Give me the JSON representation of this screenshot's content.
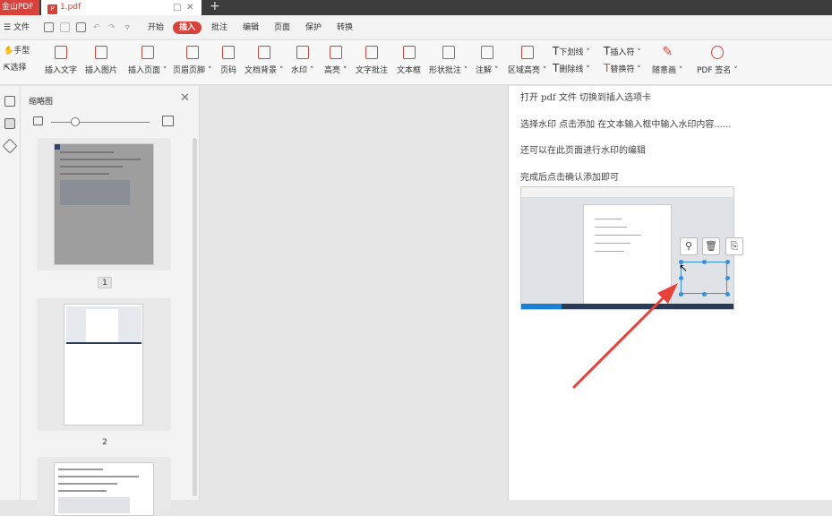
{
  "titlebar": {
    "app_name": "金山PDF",
    "doc_tab": "1.pdf",
    "new_tab_symbol": "+"
  },
  "menu": {
    "file": "文件",
    "items": [
      "开始",
      "插入",
      "批注",
      "编辑",
      "页面",
      "保护",
      "转换"
    ],
    "active": "插入"
  },
  "toolbar": {
    "hand": "手型",
    "select": "选择",
    "insert_text": "插入文字",
    "insert_image": "插入图片",
    "insert_page": "插入页面",
    "header_footer": "页眉页脚",
    "page_number": "页码",
    "doc_background": "文档背景",
    "watermark": "水印",
    "highlight": "高亮",
    "text_annotation": "文字批注",
    "text_box": "文本框",
    "shape_annotation": "形状批注",
    "note": "注解",
    "area_highlight": "区域高亮",
    "underline": "下划线",
    "strikethrough": "删除线",
    "insert_symbol": "插入符",
    "replace_symbol": "替换符",
    "freehand": "随意画",
    "pdf_sign": "PDF 签名"
  },
  "thumbnail_panel": {
    "title": "缩略图",
    "pages": [
      "1",
      "2"
    ],
    "selected": "1"
  },
  "document": {
    "lines": [
      "打开 pdf 文件   切换到插入选项卡",
      "选择水印     点击添加    在文本输入框中输入水印内容......",
      "还可以在此页面进行水印的编辑",
      "完成后点击确认添加即可"
    ]
  },
  "colors": {
    "brand_red": "#d9413b",
    "arrow_red": "#e8413a",
    "selection_blue": "#3a8fdc"
  },
  "icons": [
    "bookmark-icon",
    "thumbnail-icon",
    "layers-icon",
    "close-icon",
    "pin-icon",
    "trash-icon",
    "copy-icon",
    "cursor-icon"
  ]
}
